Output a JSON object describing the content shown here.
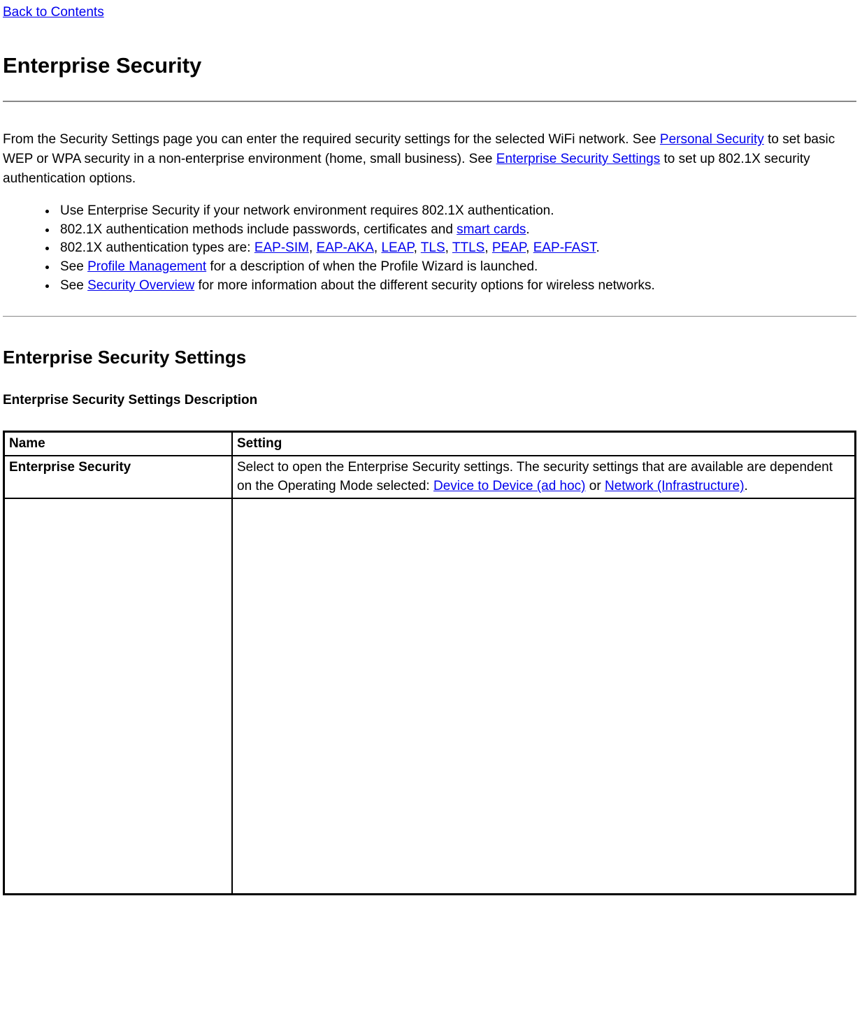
{
  "nav": {
    "back_label": "Back to Contents"
  },
  "headings": {
    "h1": "Enterprise Security",
    "h2": "Enterprise Security Settings",
    "h3": "Enterprise Security Settings Description"
  },
  "intro": {
    "part1": "From the Security Settings page you can enter the required security settings for the selected WiFi network. See ",
    "link_personal": "Personal Security",
    "part2": " to set basic WEP or WPA security in a non-enterprise environment (home, small business). See ",
    "link_ess": "Enterprise Security Settings",
    "part3": " to set up 802.1X security authentication options."
  },
  "bullets": {
    "b1": "Use Enterprise Security if your network environment requires 802.1X authentication.",
    "b2_pre": "802.1X authentication methods include passwords, certificates and ",
    "b2_link": "smart cards",
    "b2_post": ".",
    "b3_pre": "802.1X authentication types are: ",
    "b3_links": {
      "eap_sim": "EAP-SIM",
      "eap_aka": "EAP-AKA",
      "leap": "LEAP",
      "tls": "TLS",
      "ttls": "TTLS",
      "peap": "PEAP",
      "eap_fast": "EAP-FAST"
    },
    "b3_sep": ", ",
    "b3_post": ".",
    "b4_pre": "See ",
    "b4_link": "Profile Management",
    "b4_post": " for a description of when the Profile Wizard is launched.",
    "b5_pre": "See ",
    "b5_link": "Security Overview",
    "b5_post": " for more information about the different security options for wireless networks."
  },
  "table": {
    "headers": {
      "name": "Name",
      "setting": "Setting"
    },
    "row1": {
      "name": "Enterprise Security",
      "setting_pre": "Select to open the Enterprise Security settings. The security settings that are available are dependent on the Operating Mode selected: ",
      "link_d2d": "Device to Device (ad hoc)",
      "setting_mid": " or ",
      "link_net": "Network (Infrastructure)",
      "setting_post": "."
    }
  }
}
